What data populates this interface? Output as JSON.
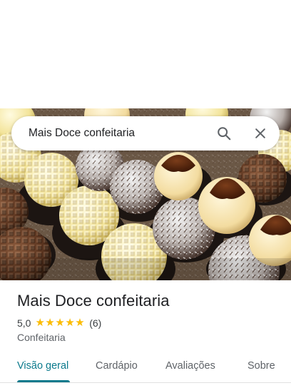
{
  "search": {
    "query": "Mais Doce confeitaria",
    "search_icon": "search-icon",
    "clear_icon": "close-icon"
  },
  "place": {
    "name": "Mais Doce confeitaria",
    "rating": "5,0",
    "stars": 5,
    "review_count": "(6)",
    "category": "Confeitaria"
  },
  "tabs": [
    {
      "label": "Visão geral",
      "active": true
    },
    {
      "label": "Cardápio",
      "active": false
    },
    {
      "label": "Avaliações",
      "active": false
    },
    {
      "label": "Sobre",
      "active": false
    }
  ],
  "colors": {
    "accent": "#0b7a8c",
    "star": "#fbbc04"
  }
}
